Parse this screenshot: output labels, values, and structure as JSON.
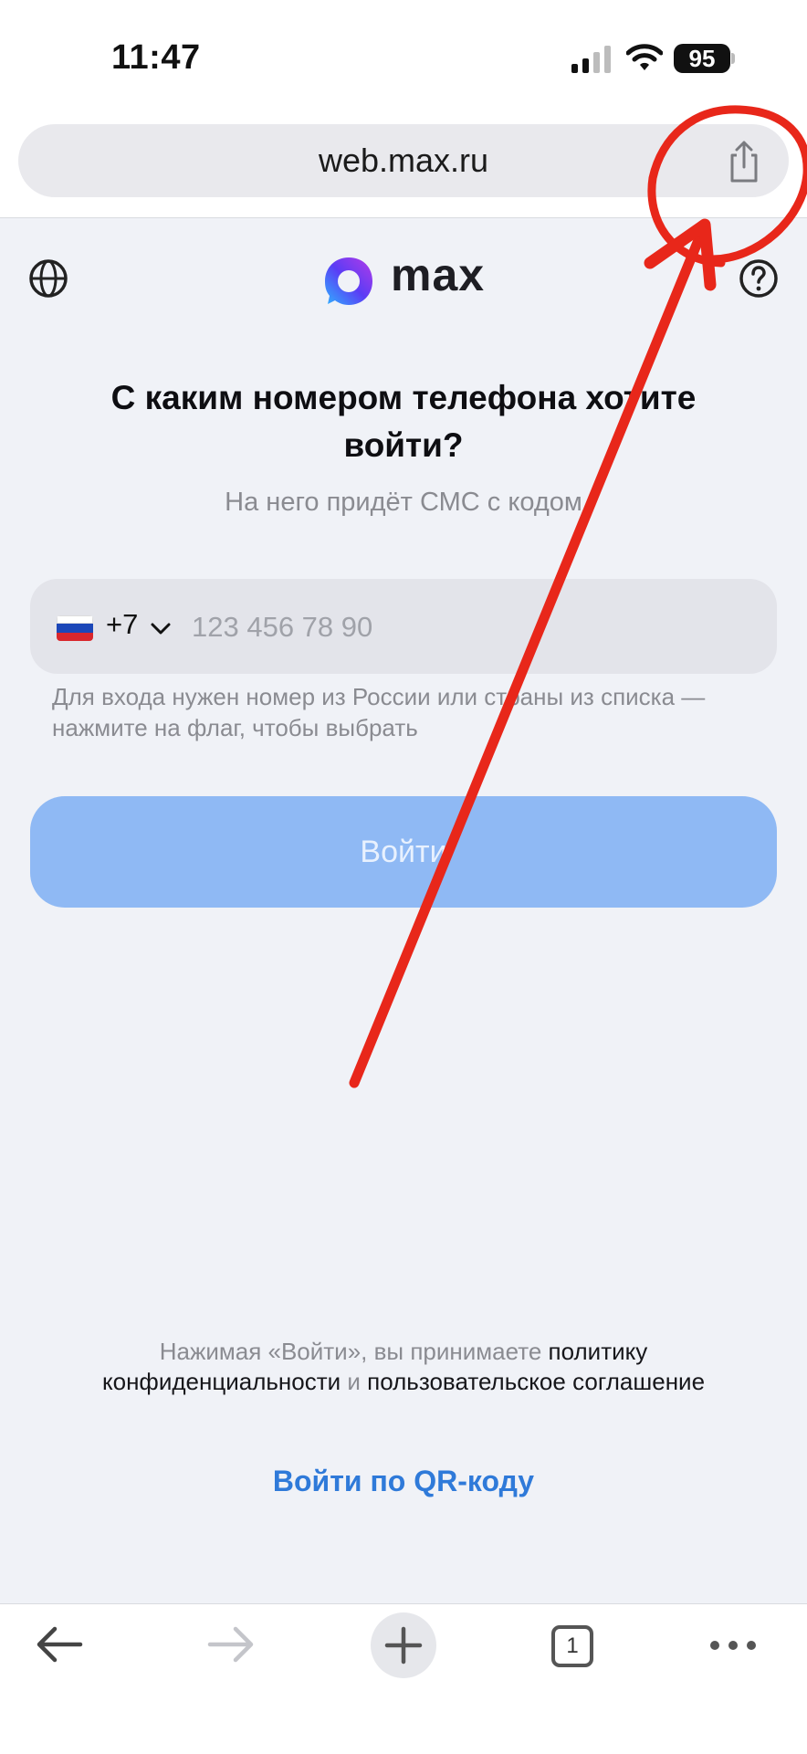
{
  "status_bar": {
    "time": "11:47",
    "battery": "95"
  },
  "browser": {
    "url": "web.max.ru",
    "tab_count": "1"
  },
  "header": {
    "logo_text": "max"
  },
  "login": {
    "title": "С каким номером телефона хотите войти?",
    "subtitle": "На него придёт СМС с кодом",
    "country_code": "+7",
    "phone_placeholder": "123 456 78 90",
    "hint": "Для входа нужен номер из России или страны из списка — нажмите на флаг, чтобы выбрать",
    "submit_label": "Войти"
  },
  "legal": {
    "prefix": "Нажимая «Войти», вы принимаете ",
    "privacy_link": "политику конфиденциальности",
    "conjunction": " и ",
    "terms_link": "пользовательское соглашение"
  },
  "qr_login_label": "Войти по QR-коду",
  "colors": {
    "accent": "#2f7ad9",
    "button_disabled": "#8fb9f4",
    "annotation": "#e8271a"
  }
}
